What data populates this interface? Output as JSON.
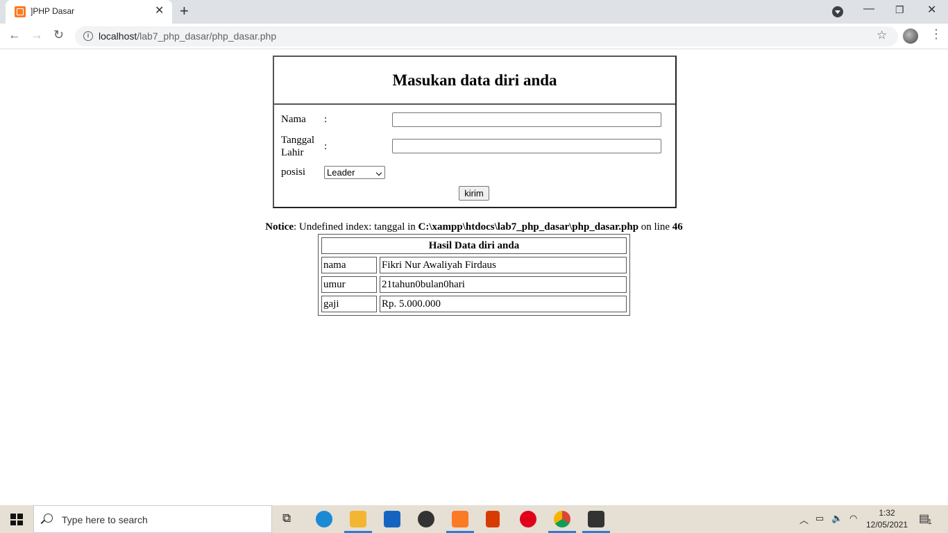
{
  "browser": {
    "tab_title": "]PHP Dasar",
    "url_host": "localhost",
    "url_path": "/lab7_php_dasar/php_dasar.php"
  },
  "form": {
    "title": "Masukan data diri anda",
    "nama_label": "Nama",
    "tanggal_label": "Tanggal Lahir",
    "colon": ":",
    "posisi_label": "posisi",
    "posisi_selected": "Leader",
    "submit_label": "kirim",
    "nama_value": "",
    "tanggal_value": ""
  },
  "notice": {
    "label": "Notice",
    "message": ": Undefined index: tanggal in ",
    "path": "C:\\xampp\\htdocs\\lab7_php_dasar\\php_dasar.php",
    "on_line": " on line ",
    "line": "46"
  },
  "result": {
    "title": "Hasil Data diri anda",
    "rows": [
      {
        "key": "nama",
        "value": "Fikri Nur Awaliyah Firdaus"
      },
      {
        "key": "umur",
        "value": "21tahun0bulan0hari"
      },
      {
        "key": "gaji",
        "value": "Rp. 5.000.000"
      }
    ]
  },
  "taskbar": {
    "search_placeholder": "Type here to search",
    "time": "1:32",
    "date": "12/05/2021",
    "notification_count": "1"
  },
  "colors": {
    "xampp": "#fb7a24",
    "edge": "#1a8ad4",
    "files": "#f2b632",
    "mail": "#1565c0",
    "opera": "#e0001a",
    "office": "#d83b01",
    "sublime": "#ff9800"
  }
}
